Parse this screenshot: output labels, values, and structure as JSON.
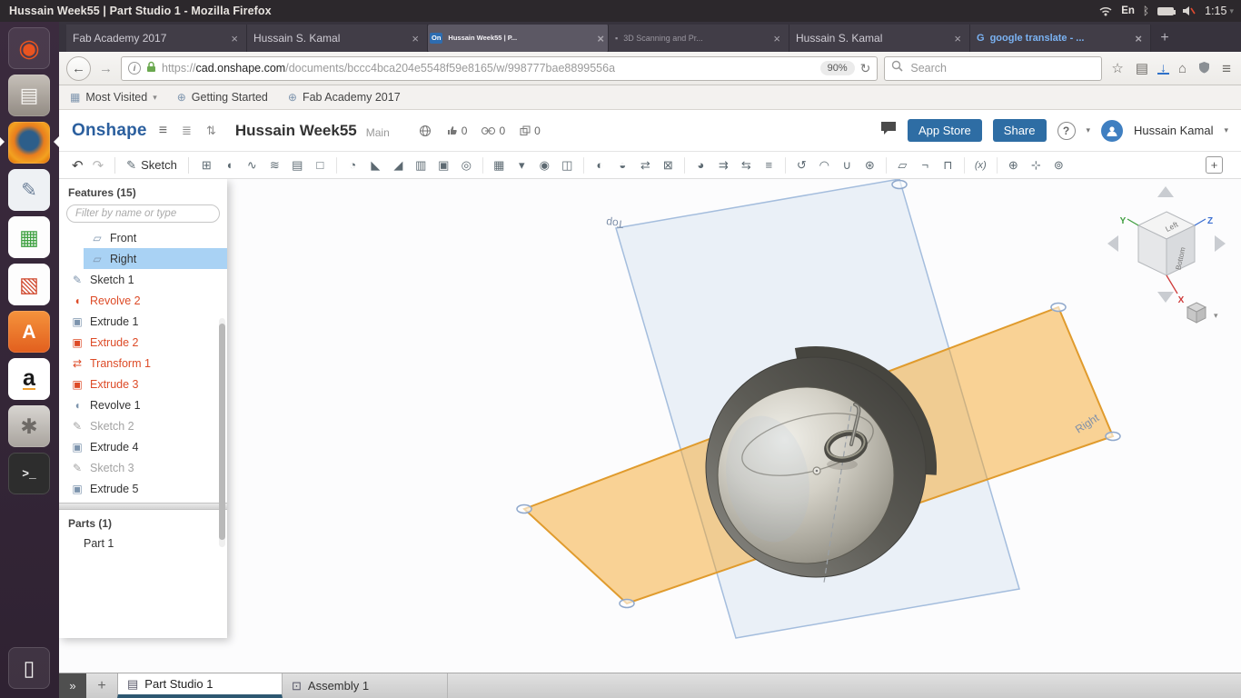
{
  "colors": {
    "onshape_blue": "#2e6da4",
    "selection_blue": "#a9d2f4",
    "error_red": "#dd4b27",
    "plane_orange": "#f5a62e",
    "launcher_purple": "#3b2b3e",
    "active_tab_underline": "#2e5871"
  },
  "glyphs": {
    "close": "×",
    "new_tab": "+",
    "back": "←",
    "forward": "→",
    "reload": "↻",
    "info": "i",
    "star": "☆",
    "reading_list": "▤",
    "download": "↓",
    "home": "⌂",
    "menu": "≡",
    "caret": "▾",
    "undo": "↶",
    "redo": "↷",
    "pencil": "✎",
    "doc_menu": "≡",
    "versions": "≣",
    "compare": "⇅",
    "bluetooth": "ᛒ",
    "toolbar_plus": "+"
  },
  "desktop": {
    "topbar": {
      "title": "Hussain Week55 | Part Studio 1 - Mozilla Firefox",
      "language": "En",
      "time": "1:15"
    },
    "launcher": [
      {
        "name": "dash-home-launcher-icon",
        "tile": "dash",
        "glyph": "◉"
      },
      {
        "name": "files-launcher-icon",
        "tile": "files",
        "glyph": "▤"
      },
      {
        "name": "firefox-launcher-icon",
        "tile": "firefox",
        "glyph": "",
        "focused": true
      },
      {
        "name": "text-editor-launcher-icon",
        "tile": "gedit",
        "glyph": "✎"
      },
      {
        "name": "libreoffice-calc-launcher-icon",
        "tile": "calc",
        "glyph": "▦"
      },
      {
        "name": "libreoffice-impress-launcher-icon",
        "tile": "impress",
        "glyph": "▧"
      },
      {
        "name": "ubuntu-software-launcher-icon",
        "tile": "software",
        "glyph": "A"
      },
      {
        "name": "amazon-launcher-icon",
        "tile": "amazon",
        "glyph": "a"
      },
      {
        "name": "system-settings-launcher-icon",
        "tile": "settings",
        "glyph": "✱"
      },
      {
        "name": "terminal-launcher-icon",
        "tile": "terminal",
        "glyph": ">_"
      },
      {
        "name": "trash-launcher-icon",
        "tile": "trash",
        "glyph": "▯"
      }
    ]
  },
  "browser": {
    "tabs": [
      {
        "label": "Fab Academy 2017",
        "favicon": "",
        "fc": "none"
      },
      {
        "label": "Hussain S. Kamal",
        "favicon": "",
        "fc": "none"
      },
      {
        "label": "Hussain Week55 | P...",
        "favicon": "On",
        "fc": "onshape",
        "active": true
      },
      {
        "label": "3D Scanning and Pr...",
        "favicon": "▪",
        "fc": "generic"
      },
      {
        "label": "Hussain S. Kamal",
        "favicon": "",
        "fc": "none"
      },
      {
        "label": "google translate - ...",
        "favicon": "G",
        "fc": "google"
      }
    ],
    "nav": {
      "url_prefix": "https://",
      "url_host": "cad.onshape.com",
      "url_path": "/documents/bccc4bca204e5548f59e8165/w/998777bae8899556a",
      "zoom_badge": "90%",
      "search_placeholder": "Search"
    },
    "bookmarks": [
      {
        "label": "Most Visited",
        "icon": "▦",
        "caret": "▾"
      },
      {
        "label": "Getting Started",
        "icon": "⊕",
        "caret": ""
      },
      {
        "label": "Fab Academy 2017",
        "icon": "⊕",
        "caret": ""
      }
    ]
  },
  "onshape": {
    "header": {
      "logo": "Onshape",
      "doc_title": "Hussain Week55",
      "workspace": "Main",
      "like_count": "0",
      "link_count": "0",
      "copy_count": "0",
      "app_store_label": "App Store",
      "share_label": "Share",
      "help_label": "?",
      "user_name": "Hussain Kamal"
    },
    "toolbar": {
      "sketch_label": "Sketch",
      "icons": [
        {
          "name": "extrude-icon",
          "glyph": "⊞"
        },
        {
          "name": "revolve-icon",
          "glyph": "◖"
        },
        {
          "name": "sweep-icon",
          "glyph": "∿"
        },
        {
          "name": "loft-icon",
          "glyph": "≋"
        },
        {
          "name": "thicken-icon",
          "glyph": "▤"
        },
        {
          "name": "enclose-icon",
          "glyph": "□"
        },
        {
          "sep": true
        },
        {
          "name": "fillet-icon",
          "glyph": "◔"
        },
        {
          "name": "chamfer-icon",
          "glyph": "◣"
        },
        {
          "name": "draft-icon",
          "glyph": "◢"
        },
        {
          "name": "rib-icon",
          "glyph": "▥"
        },
        {
          "name": "shell-icon",
          "glyph": "▣"
        },
        {
          "name": "hole-icon",
          "glyph": "◎"
        },
        {
          "sep": true
        },
        {
          "name": "linear-pattern-icon",
          "glyph": "▦"
        },
        {
          "name": "pattern-dropdown-icon",
          "glyph": "▾"
        },
        {
          "name": "circular-pattern-icon",
          "glyph": "◉"
        },
        {
          "name": "mirror-icon",
          "glyph": "◫"
        },
        {
          "sep": true
        },
        {
          "name": "boolean-icon",
          "glyph": "◐"
        },
        {
          "name": "split-icon",
          "glyph": "◒"
        },
        {
          "name": "transform-icon",
          "glyph": "⇄"
        },
        {
          "name": "delete-part-icon",
          "glyph": "⊠"
        },
        {
          "sep": true
        },
        {
          "name": "modify-fillet-icon",
          "glyph": "◕"
        },
        {
          "name": "move-face-icon",
          "glyph": "⇉"
        },
        {
          "name": "replace-face-icon",
          "glyph": "⇆"
        },
        {
          "name": "offset-surface-icon",
          "glyph": "≡"
        },
        {
          "sep": true
        },
        {
          "name": "helix-icon",
          "glyph": "↺"
        },
        {
          "name": "projected-curve-icon",
          "glyph": "◠"
        },
        {
          "name": "bridging-curve-icon",
          "glyph": "∪"
        },
        {
          "name": "composite-curve-icon",
          "glyph": "⊛"
        },
        {
          "sep": true
        },
        {
          "name": "sheet-metal-icon",
          "glyph": "▱"
        },
        {
          "name": "flange-icon",
          "glyph": "¬"
        },
        {
          "name": "sheet-metal-tab-icon",
          "glyph": "⊓"
        },
        {
          "sep": true
        },
        {
          "name": "variable-icon",
          "glyph": "(x)"
        },
        {
          "sep": true
        },
        {
          "name": "in-context-icon",
          "glyph": "⊕"
        },
        {
          "name": "measure-icon",
          "glyph": "⊹"
        },
        {
          "name": "mass-properties-icon",
          "glyph": "⊚"
        }
      ]
    },
    "features_panel": {
      "title": "Features (15)",
      "filter_placeholder": "Filter by name or type",
      "items": [
        {
          "label": "Front",
          "type": "plane",
          "glyph": "▱",
          "state": "normal"
        },
        {
          "label": "Right",
          "type": "plane",
          "glyph": "▱",
          "state": "selected"
        },
        {
          "label": "Sketch 1",
          "type": "sketch",
          "glyph": "✎",
          "state": "normal"
        },
        {
          "label": "Revolve 2",
          "type": "revolve",
          "glyph": "◖",
          "state": "error"
        },
        {
          "label": "Extrude 1",
          "type": "extrude",
          "glyph": "▣",
          "state": "normal"
        },
        {
          "label": "Extrude 2",
          "type": "extrude",
          "glyph": "▣",
          "state": "error"
        },
        {
          "label": "Transform 1",
          "type": "transform",
          "glyph": "⇄",
          "state": "error"
        },
        {
          "label": "Extrude 3",
          "type": "extrude",
          "glyph": "▣",
          "state": "error"
        },
        {
          "label": "Revolve 1",
          "type": "revolve",
          "glyph": "◖",
          "state": "normal"
        },
        {
          "label": "Sketch 2",
          "type": "sketch",
          "glyph": "✎",
          "state": "suppressed"
        },
        {
          "label": "Extrude 4",
          "type": "extrude",
          "glyph": "▣",
          "state": "normal"
        },
        {
          "label": "Sketch 3",
          "type": "sketch",
          "glyph": "✎",
          "state": "suppressed"
        },
        {
          "label": "Extrude 5",
          "type": "extrude",
          "glyph": "▣",
          "state": "normal"
        }
      ],
      "parts_title": "Parts (1)",
      "parts": [
        "Part 1"
      ]
    },
    "viewport": {
      "top_plane_label": "Top",
      "right_plane_label": "Right",
      "view_cube": {
        "left_label": "Left",
        "bottom_label": "Bottom",
        "axis_x": "X",
        "axis_y": "Y",
        "axis_z": "Z"
      }
    },
    "bottom_bar": {
      "chevron": "»",
      "add_label": "+",
      "tabs": [
        {
          "label": "Part Studio 1",
          "glyph": "▤",
          "active": true
        },
        {
          "label": "Assembly 1",
          "glyph": "⊡"
        }
      ]
    }
  }
}
